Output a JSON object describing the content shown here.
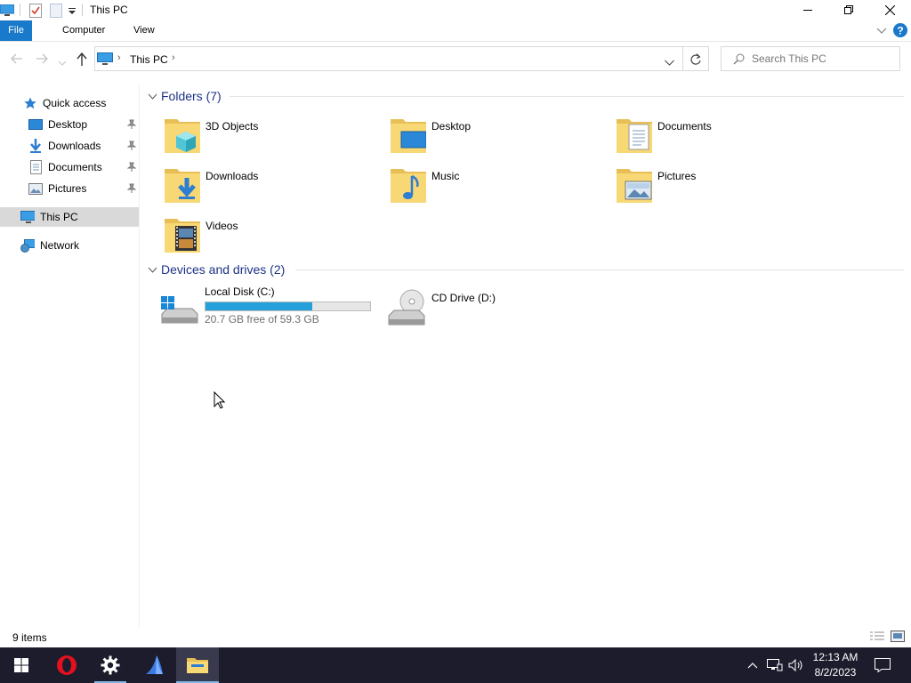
{
  "window": {
    "title": "This PC"
  },
  "ribbon": {
    "tabs": [
      "File",
      "Computer",
      "View"
    ]
  },
  "address": {
    "path": "This PC"
  },
  "search": {
    "placeholder": "Search This PC"
  },
  "nav": {
    "items": [
      {
        "label": "Quick access",
        "icon": "star-icon"
      },
      {
        "label": "Desktop",
        "icon": "desktop-folder-icon",
        "pinned": true
      },
      {
        "label": "Downloads",
        "icon": "downloads-folder-icon",
        "pinned": true
      },
      {
        "label": "Documents",
        "icon": "documents-folder-icon",
        "pinned": true
      },
      {
        "label": "Pictures",
        "icon": "pictures-folder-icon",
        "pinned": true
      },
      {
        "label": "This PC",
        "icon": "computer-icon",
        "selected": true
      },
      {
        "label": "Network",
        "icon": "network-icon"
      }
    ]
  },
  "folders": {
    "header": "Folders (7)",
    "items": [
      {
        "label": "3D Objects",
        "icon": "3d-objects-folder-icon"
      },
      {
        "label": "Desktop",
        "icon": "desktop-folder-icon"
      },
      {
        "label": "Documents",
        "icon": "documents-folder-icon"
      },
      {
        "label": "Downloads",
        "icon": "downloads-folder-icon"
      },
      {
        "label": "Music",
        "icon": "music-folder-icon"
      },
      {
        "label": "Pictures",
        "icon": "pictures-folder-icon"
      },
      {
        "label": "Videos",
        "icon": "videos-folder-icon"
      }
    ]
  },
  "drives": {
    "header": "Devices and drives (2)",
    "items": [
      {
        "label": "Local Disk (C:)",
        "free_text": "20.7 GB free of 59.3 GB",
        "used_fraction": 0.65,
        "icon": "local-disk-icon"
      },
      {
        "label": "CD Drive (D:)",
        "icon": "cd-drive-icon"
      }
    ]
  },
  "status": {
    "item_count": "9 items"
  },
  "taskbar": {
    "time": "12:13 AM",
    "date": "8/2/2023"
  },
  "colors": {
    "accent": "#1979ca",
    "header_text": "#1e3287",
    "taskbar": "#1c1c2c",
    "bar_fill": "#26a0da"
  }
}
